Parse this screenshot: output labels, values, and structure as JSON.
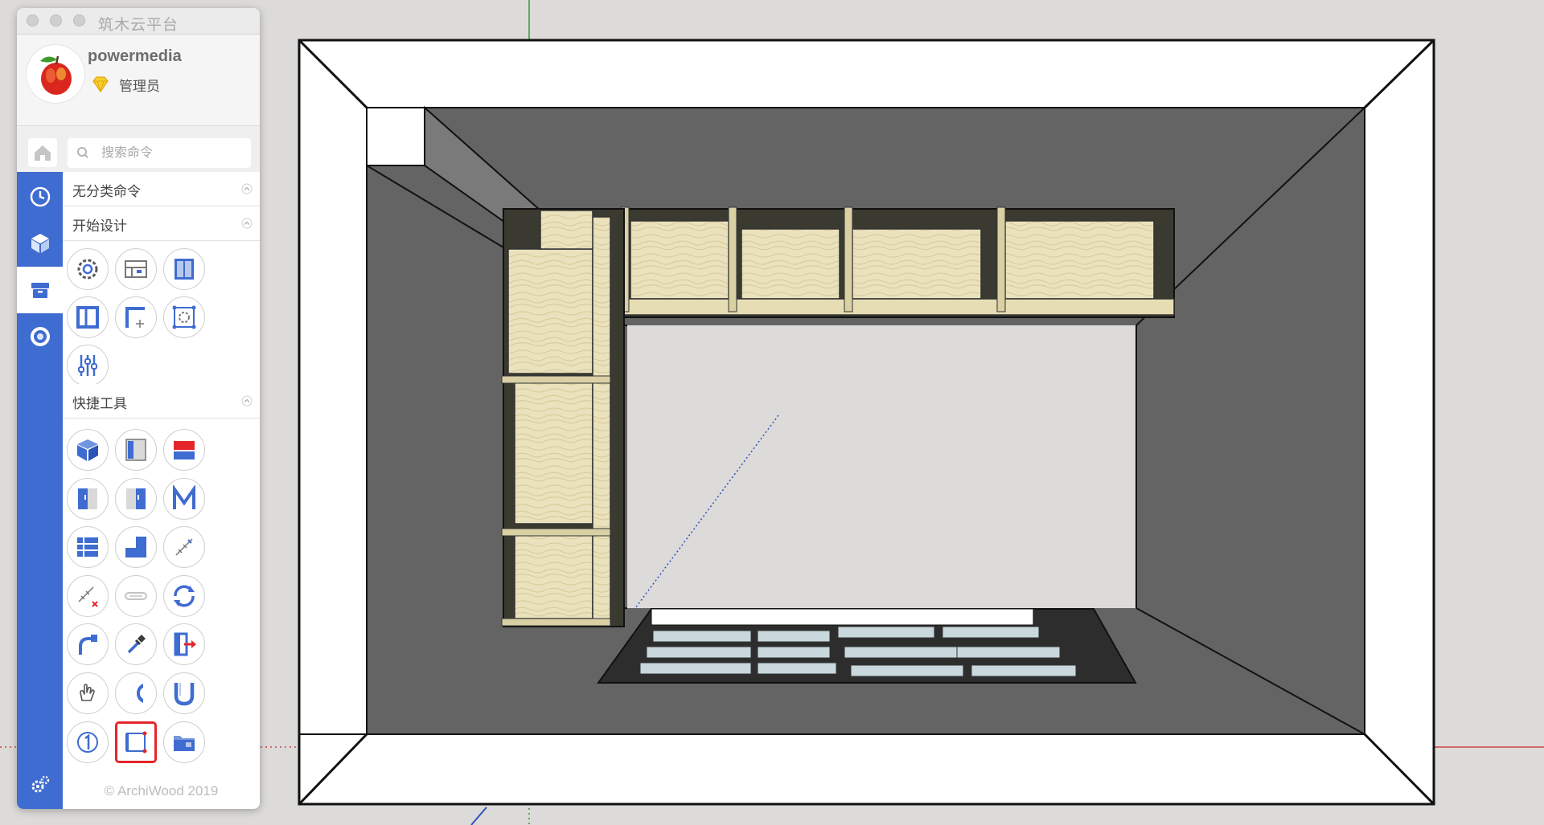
{
  "window": {
    "title": "筑木云平台"
  },
  "user": {
    "name": "powermedia",
    "role": "管理员"
  },
  "search": {
    "placeholder": "搜索命令"
  },
  "sections": [
    {
      "label": "无分类命令"
    },
    {
      "label": "开始设计"
    },
    {
      "label": "快捷工具"
    }
  ],
  "footer": {
    "copyright": "© ArchiWood 2019"
  },
  "nav_items": [
    "history-icon",
    "cube-icon",
    "box-icon",
    "ring-icon",
    "settings-icon"
  ],
  "colors": {
    "accent": "#3f6cd0",
    "selected_border": "#e4262b",
    "wood": "#e9dfb6",
    "wall": "#646464"
  }
}
